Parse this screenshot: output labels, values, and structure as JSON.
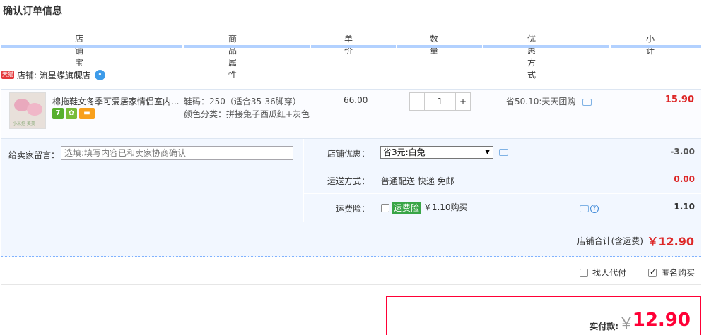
{
  "page": {
    "title": "确认订单信息"
  },
  "columns": [
    "店铺宝贝",
    "商品属性",
    "单价",
    "数量",
    "优惠方式",
    "小计"
  ],
  "shop": {
    "badge": "天猫",
    "label": "店铺: 流星蝶旗舰店"
  },
  "item": {
    "title": "棉拖鞋女冬季可爱居家情侣室内...",
    "thumb_caption": "小米拖·美美",
    "svc_icons": [
      "seven-day-return-icon",
      "guarantee-icon",
      "credit-card-icon"
    ],
    "svc_glyphs": [
      "7",
      "✿",
      "▬"
    ],
    "attr_size": "鞋码：250（适合35-36脚穿）",
    "attr_color": "颜色分类：拼接兔子西瓜红+灰色",
    "price": "66.00",
    "qty": {
      "minus": "-",
      "value": "1",
      "plus": "+"
    },
    "promo": "省50.10:天天团购",
    "subtotal": "15.90"
  },
  "message": {
    "label": "给卖家留言：",
    "placeholder": "选填:填写内容已和卖家协商确认"
  },
  "options": {
    "coupon": {
      "label": "店铺优惠：",
      "value": "省3元:白兔",
      "amount": "-3.00"
    },
    "shipping": {
      "label": "运送方式：",
      "value": "普通配送 快递 免邮",
      "amount": "0.00"
    },
    "insurance": {
      "label": "运费险：",
      "badge": "运费险",
      "value": "￥1.10购买",
      "amount": "1.10"
    }
  },
  "shop_total": {
    "label": "店铺合计(含运费)",
    "amount": "￥12.90"
  },
  "payment": {
    "proxy_pay": "找人代付",
    "anonymous": "匿名购买"
  },
  "final": {
    "label": "实付款:",
    "yen": "￥",
    "amount": "12.90"
  },
  "colors": {
    "accent_red": "#dd2727",
    "final_red": "#ff0036",
    "header_line": "#b2d1ff",
    "block_bg": "#f2f7ff"
  }
}
